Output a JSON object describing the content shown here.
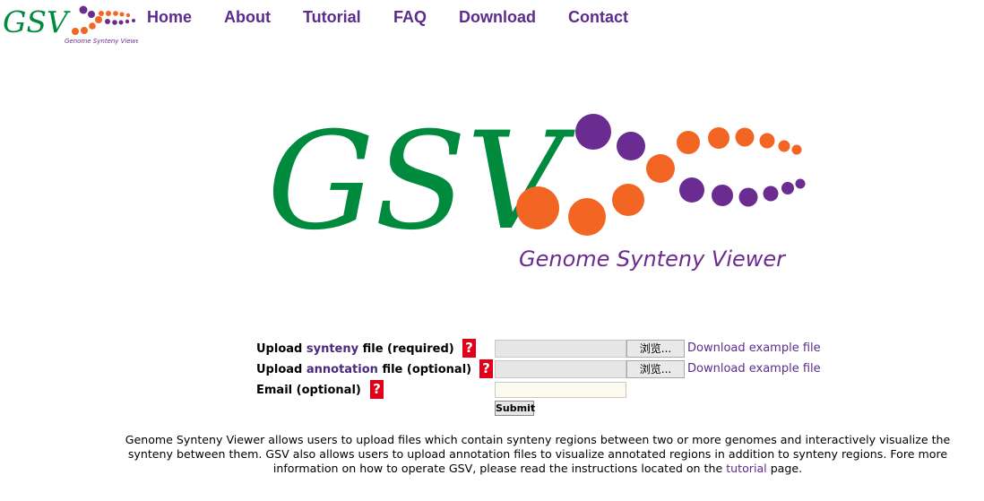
{
  "header": {
    "logo_text": "GSV",
    "logo_tagline": "Genome Synteny Viewer"
  },
  "nav": {
    "items": [
      {
        "label": "Home"
      },
      {
        "label": "About"
      },
      {
        "label": "Tutorial"
      },
      {
        "label": "FAQ"
      },
      {
        "label": "Download"
      },
      {
        "label": "Contact"
      }
    ]
  },
  "main_logo": {
    "text": "GSV",
    "tagline": "Genome Synteny Viewer"
  },
  "form": {
    "synteny": {
      "label_prefix": "Upload ",
      "label_keyword": "synteny",
      "label_suffix": " file (required)",
      "help": "?",
      "browse_label": "浏览...",
      "example_link": "Download example file"
    },
    "annotation": {
      "label_prefix": "Upload ",
      "label_keyword": "annotation",
      "label_suffix": " file (optional)",
      "help": "?",
      "browse_label": "浏览...",
      "example_link": "Download example file"
    },
    "email": {
      "label": "Email (optional)",
      "help": "?",
      "value": ""
    },
    "submit_label": "Submit"
  },
  "description": {
    "text_before_link": "Genome Synteny Viewer allows users to upload files which contain synteny regions between two or more genomes and interactively visualize the synteny between them. GSV also allows users to upload annotation files to visualize annotated regions in addition to synteny regions. Fore more information on how to operate GSV, please read the instructions located on the ",
    "link_text": "tutorial",
    "text_after_link": " page."
  },
  "colors": {
    "green": "#008a3e",
    "purple": "#6b2c91",
    "orange": "#f26522",
    "nav_text": "#5c2c8c",
    "help_red": "#e0001a"
  }
}
